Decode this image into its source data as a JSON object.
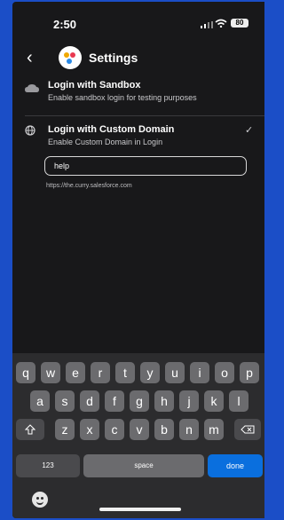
{
  "status_bar": {
    "time": "2:50",
    "battery": "80"
  },
  "nav": {
    "title": "Settings"
  },
  "options": [
    {
      "title": "Login with Sandbox",
      "subtitle": "Enable sandbox login for testing purposes",
      "selected": false
    },
    {
      "title": "Login with Custom Domain",
      "subtitle": "Enable Custom Domain in Login",
      "selected": true
    }
  ],
  "custom_domain": {
    "value": "help",
    "example": "https://the.curry.salesforce.com"
  },
  "keyboard": {
    "row1": [
      "q",
      "w",
      "e",
      "r",
      "t",
      "y",
      "u",
      "i",
      "o",
      "p"
    ],
    "row2": [
      "a",
      "s",
      "d",
      "f",
      "g",
      "h",
      "j",
      "k",
      "l"
    ],
    "row3": [
      "z",
      "x",
      "c",
      "v",
      "b",
      "n",
      "m"
    ],
    "numbers_label": "123",
    "space_label": "space",
    "done_label": "done"
  },
  "colors": {
    "accent": "#0a6fde",
    "background": "#18181a",
    "frame": "#1b4ec7"
  }
}
